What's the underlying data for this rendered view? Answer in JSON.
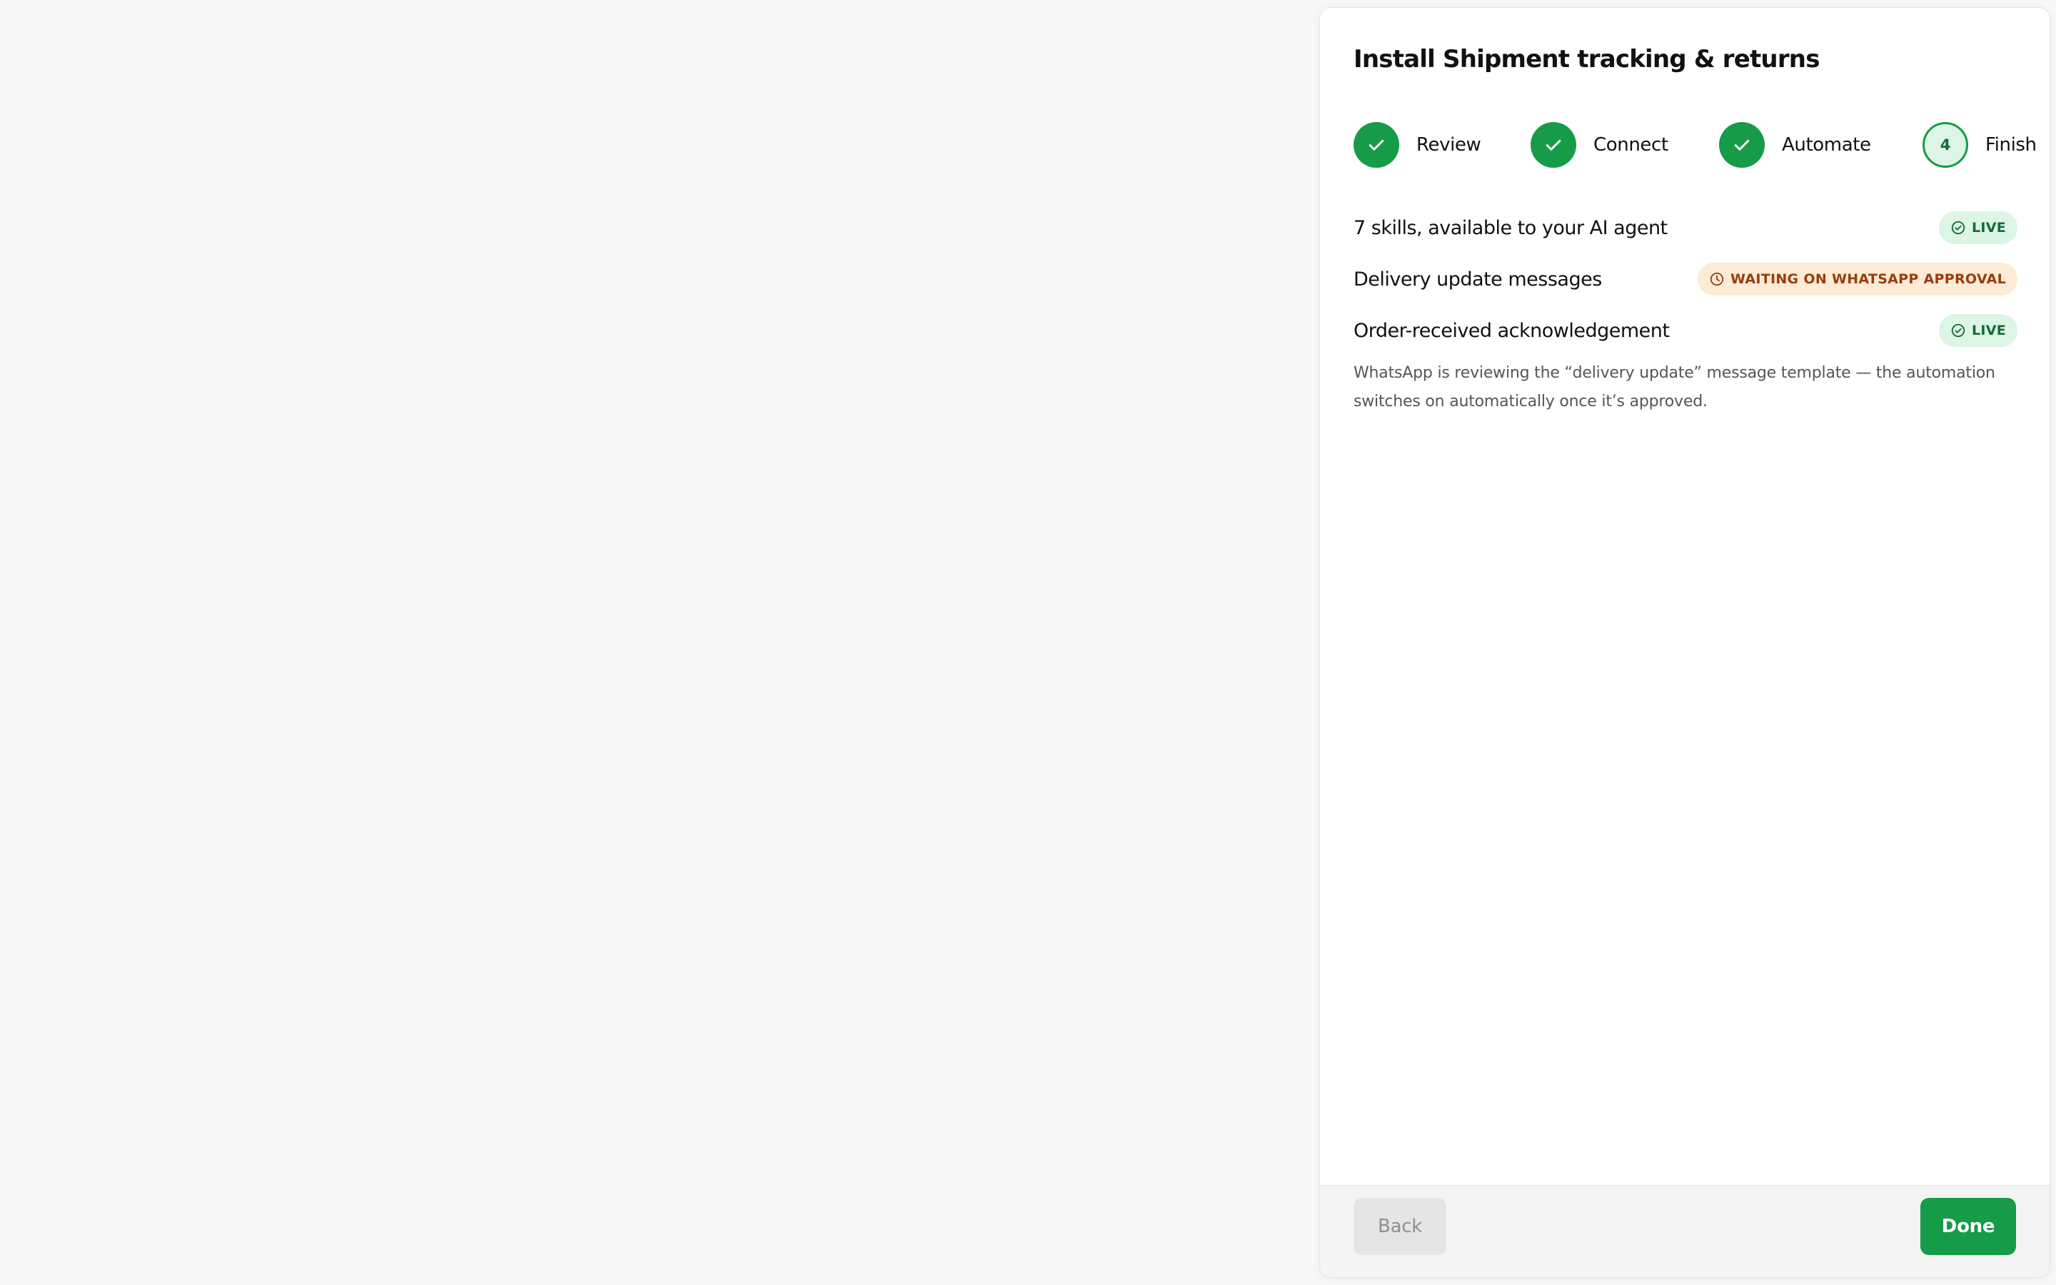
{
  "dialog": {
    "title": "Install Shipment tracking & returns",
    "accent_color": "#169b48"
  },
  "steps": [
    {
      "label": "Review",
      "state": "done",
      "icon": "check-icon"
    },
    {
      "label": "Connect",
      "state": "done",
      "icon": "check-icon"
    },
    {
      "label": "Automate",
      "state": "done",
      "icon": "check-icon"
    },
    {
      "label": "Finish",
      "state": "current",
      "number": "4"
    }
  ],
  "items": [
    {
      "label": "7 skills, available to your AI agent",
      "status": "LIVE",
      "status_icon": "check-circle-icon"
    },
    {
      "label": "Delivery update messages",
      "status": "WAITING ON WHATSAPP APPROVAL",
      "status_icon": "clock-icon"
    },
    {
      "label": "Order-received acknowledgement",
      "status": "LIVE",
      "status_icon": "check-circle-icon"
    }
  ],
  "note": "WhatsApp is reviewing the “delivery update” message template — the automation switches on automatically once it’s approved.",
  "footer": {
    "back_label": "Back",
    "done_label": "Done"
  },
  "colors": {
    "live_bg": "#dcf5e4",
    "live_text": "#146b36",
    "waiting_bg": "#fdebd6",
    "waiting_text": "#9a3c10"
  }
}
